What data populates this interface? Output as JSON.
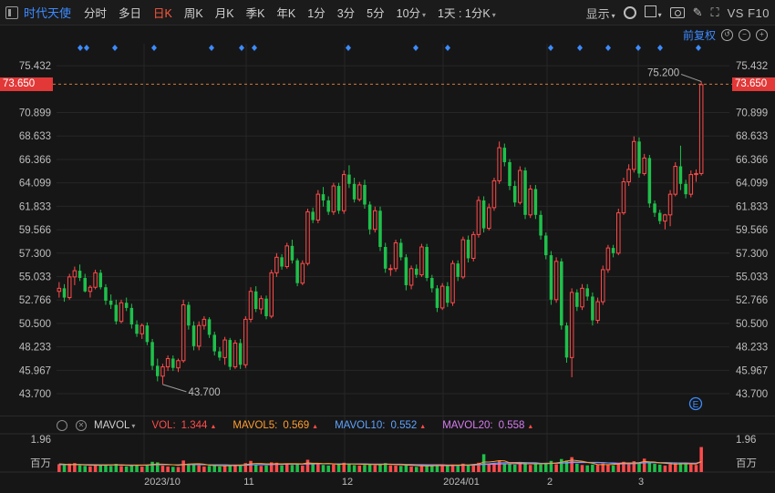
{
  "toolbar": {
    "app_title": "时代天使",
    "periods": [
      "分时",
      "多日",
      "日K",
      "周K",
      "月K",
      "季K",
      "年K",
      "1分",
      "3分",
      "5分",
      "10分",
      "1天 : 1分K"
    ],
    "active_period": "日K",
    "display_label": "显示",
    "f10_label": "VS F10"
  },
  "adjust": {
    "label": "前复权"
  },
  "price_axis": {
    "ticks": [
      "75.432",
      "73.650",
      "70.899",
      "68.633",
      "66.366",
      "64.099",
      "61.833",
      "59.566",
      "57.300",
      "55.033",
      "52.766",
      "50.500",
      "48.233",
      "45.967",
      "43.700"
    ],
    "current_price": "73.650"
  },
  "annotations": {
    "high": "75.200",
    "low": "43.700",
    "event_marker": "E"
  },
  "volume": {
    "indicator_name": "MAVOL",
    "vol_label": "VOL:",
    "vol_value": "1.344",
    "mavol5_label": "MAVOL5:",
    "mavol5_value": "0.569",
    "mavol10_label": "MAVOL10:",
    "mavol10_value": "0.552",
    "mavol20_label": "MAVOL20:",
    "mavol20_value": "0.558",
    "axis_top": "1.96",
    "axis_unit": "百万"
  },
  "date_axis": {
    "labels": [
      "2023/10",
      "11",
      "12",
      "2024/01",
      "2",
      "3"
    ]
  },
  "colors": {
    "up": "#ff4b4b",
    "down": "#1fc04b",
    "mavol5": "#ff9d2e",
    "mavol10": "#5fa3ff",
    "mavol20": "#d77cf0",
    "accent": "#3d8bff"
  },
  "chart_data": {
    "type": "candlestick",
    "y_range": [
      43.0,
      76.5
    ],
    "volume_range": [
      0,
      1.96
    ],
    "candles": [
      [
        53.6,
        54.5,
        53.0,
        53.9
      ],
      [
        53.9,
        54.3,
        52.6,
        53.0
      ],
      [
        53.0,
        55.3,
        52.8,
        55.0
      ],
      [
        55.0,
        56.0,
        54.2,
        55.6
      ],
      [
        55.6,
        56.2,
        54.6,
        54.9
      ],
      [
        54.9,
        55.3,
        53.5,
        53.6
      ],
      [
        53.6,
        54.2,
        53.0,
        54.0
      ],
      [
        54.0,
        55.7,
        53.8,
        55.4
      ],
      [
        55.4,
        55.7,
        53.8,
        54.0
      ],
      [
        54.0,
        54.3,
        52.3,
        52.7
      ],
      [
        52.7,
        53.3,
        51.9,
        52.3
      ],
      [
        52.3,
        52.8,
        50.4,
        50.7
      ],
      [
        50.7,
        52.8,
        50.5,
        52.5
      ],
      [
        52.5,
        53.0,
        51.7,
        52.0
      ],
      [
        52.0,
        52.4,
        50.0,
        50.4
      ],
      [
        50.4,
        50.8,
        49.2,
        49.5
      ],
      [
        49.5,
        50.5,
        49.0,
        50.3
      ],
      [
        50.3,
        50.6,
        48.4,
        48.7
      ],
      [
        48.7,
        49.0,
        46.0,
        46.4
      ],
      [
        46.4,
        47.1,
        44.9,
        45.4
      ],
      [
        45.4,
        46.6,
        44.6,
        46.3
      ],
      [
        46.3,
        47.4,
        45.9,
        47.1
      ],
      [
        47.1,
        47.4,
        45.9,
        46.2
      ],
      [
        46.2,
        47.1,
        45.8,
        46.9
      ],
      [
        46.9,
        52.8,
        46.7,
        52.3
      ],
      [
        52.3,
        52.6,
        49.9,
        50.3
      ],
      [
        50.3,
        50.7,
        47.9,
        48.3
      ],
      [
        48.3,
        50.7,
        47.9,
        50.3
      ],
      [
        50.3,
        51.2,
        49.9,
        50.9
      ],
      [
        50.9,
        51.1,
        49.1,
        49.4
      ],
      [
        49.4,
        49.7,
        47.4,
        47.8
      ],
      [
        47.8,
        48.2,
        46.9,
        47.2
      ],
      [
        47.2,
        49.2,
        46.5,
        48.9
      ],
      [
        48.9,
        49.1,
        46.0,
        46.3
      ],
      [
        46.3,
        48.9,
        46.1,
        48.6
      ],
      [
        48.6,
        49.0,
        46.1,
        46.5
      ],
      [
        46.5,
        51.2,
        46.2,
        50.9
      ],
      [
        50.9,
        54.0,
        50.6,
        53.6
      ],
      [
        53.6,
        54.1,
        51.6,
        51.9
      ],
      [
        51.9,
        53.2,
        51.4,
        52.9
      ],
      [
        52.9,
        53.2,
        50.9,
        51.2
      ],
      [
        51.2,
        55.7,
        51.0,
        55.4
      ],
      [
        55.4,
        57.3,
        55.0,
        56.9
      ],
      [
        56.9,
        57.2,
        55.7,
        56.0
      ],
      [
        56.0,
        58.3,
        55.8,
        58.0
      ],
      [
        58.0,
        58.6,
        56.3,
        56.6
      ],
      [
        56.6,
        56.8,
        54.1,
        54.4
      ],
      [
        54.4,
        56.6,
        54.2,
        56.3
      ],
      [
        56.3,
        61.6,
        56.1,
        61.3
      ],
      [
        61.3,
        61.7,
        60.2,
        60.5
      ],
      [
        60.5,
        63.4,
        60.2,
        63.0
      ],
      [
        63.0,
        63.7,
        61.8,
        62.4
      ],
      [
        62.4,
        62.8,
        61.0,
        61.3
      ],
      [
        61.3,
        64.1,
        61.0,
        63.8
      ],
      [
        63.8,
        64.1,
        61.1,
        61.4
      ],
      [
        61.4,
        65.3,
        61.1,
        64.9
      ],
      [
        64.9,
        65.8,
        63.6,
        64.0
      ],
      [
        64.0,
        64.6,
        62.2,
        62.5
      ],
      [
        62.5,
        64.2,
        62.3,
        63.9
      ],
      [
        63.9,
        64.4,
        61.6,
        62.0
      ],
      [
        62.0,
        62.3,
        59.1,
        59.6
      ],
      [
        59.6,
        61.8,
        59.3,
        61.4
      ],
      [
        61.4,
        61.8,
        57.5,
        57.9
      ],
      [
        57.9,
        58.3,
        55.4,
        55.8
      ],
      [
        55.8,
        56.2,
        55.1,
        55.8
      ],
      [
        55.8,
        58.6,
        55.5,
        58.3
      ],
      [
        58.3,
        58.7,
        56.6,
        56.9
      ],
      [
        56.9,
        57.2,
        53.7,
        54.2
      ],
      [
        54.2,
        56.1,
        53.8,
        55.8
      ],
      [
        55.8,
        56.2,
        54.9,
        55.2
      ],
      [
        55.2,
        58.2,
        55.0,
        57.9
      ],
      [
        57.9,
        58.2,
        54.6,
        54.9
      ],
      [
        54.9,
        55.2,
        53.5,
        53.9
      ],
      [
        53.9,
        54.2,
        51.6,
        52.0
      ],
      [
        52.0,
        54.4,
        51.8,
        54.1
      ],
      [
        54.1,
        54.5,
        52.1,
        52.5
      ],
      [
        52.5,
        56.6,
        52.2,
        56.3
      ],
      [
        56.3,
        56.6,
        54.6,
        55.0
      ],
      [
        55.0,
        58.9,
        54.8,
        58.6
      ],
      [
        58.6,
        59.0,
        56.4,
        56.8
      ],
      [
        56.8,
        59.4,
        56.5,
        59.1
      ],
      [
        59.1,
        62.8,
        58.8,
        62.4
      ],
      [
        62.4,
        62.8,
        59.3,
        59.7
      ],
      [
        59.7,
        62.1,
        59.5,
        61.7
      ],
      [
        61.7,
        64.6,
        61.4,
        64.3
      ],
      [
        64.3,
        68.1,
        64.0,
        67.5
      ],
      [
        67.5,
        67.9,
        65.7,
        66.1
      ],
      [
        66.1,
        66.4,
        63.4,
        63.8
      ],
      [
        63.8,
        64.3,
        61.8,
        62.2
      ],
      [
        62.2,
        65.7,
        62.0,
        65.3
      ],
      [
        65.3,
        65.6,
        60.6,
        61.0
      ],
      [
        61.0,
        63.9,
        60.7,
        63.5
      ],
      [
        63.5,
        63.9,
        60.6,
        61.0
      ],
      [
        61.0,
        61.4,
        58.6,
        59.0
      ],
      [
        59.0,
        59.3,
        56.7,
        57.1
      ],
      [
        57.1,
        57.5,
        52.3,
        52.8
      ],
      [
        52.8,
        56.9,
        52.5,
        56.5
      ],
      [
        56.5,
        56.8,
        49.9,
        50.3
      ],
      [
        50.3,
        50.6,
        46.7,
        47.2
      ],
      [
        47.2,
        53.9,
        45.3,
        53.5
      ],
      [
        53.5,
        53.8,
        51.7,
        52.1
      ],
      [
        52.1,
        54.3,
        51.8,
        53.9
      ],
      [
        53.9,
        54.3,
        52.7,
        53.1
      ],
      [
        53.1,
        53.5,
        50.3,
        50.8
      ],
      [
        50.8,
        53.0,
        50.5,
        52.6
      ],
      [
        52.6,
        56.1,
        52.3,
        55.7
      ],
      [
        55.7,
        58.1,
        55.4,
        57.8
      ],
      [
        57.8,
        58.1,
        56.9,
        57.3
      ],
      [
        57.3,
        61.6,
        57.1,
        61.2
      ],
      [
        61.2,
        64.6,
        61.0,
        64.2
      ],
      [
        64.2,
        65.9,
        63.8,
        65.4
      ],
      [
        65.4,
        68.6,
        65.1,
        68.1
      ],
      [
        68.1,
        68.5,
        64.6,
        65.0
      ],
      [
        65.0,
        66.9,
        64.8,
        66.5
      ],
      [
        66.5,
        66.8,
        61.7,
        62.1
      ],
      [
        62.1,
        62.4,
        60.8,
        61.2
      ],
      [
        61.2,
        61.5,
        60.1,
        60.4
      ],
      [
        60.4,
        61.1,
        59.6,
        61.0
      ],
      [
        61.0,
        63.4,
        59.9,
        63.0
      ],
      [
        63.0,
        66.1,
        62.8,
        65.7
      ],
      [
        65.7,
        67.7,
        63.4,
        64.0
      ],
      [
        64.0,
        64.4,
        62.6,
        63.0
      ],
      [
        63.0,
        65.3,
        62.7,
        64.9
      ],
      [
        64.9,
        65.4,
        64.2,
        65.0
      ],
      [
        65.0,
        73.9,
        64.8,
        73.6
      ]
    ],
    "volumes": [
      0.42,
      0.38,
      0.45,
      0.48,
      0.36,
      0.33,
      0.31,
      0.4,
      0.35,
      0.37,
      0.33,
      0.44,
      0.32,
      0.3,
      0.36,
      0.38,
      0.29,
      0.35,
      0.55,
      0.52,
      0.34,
      0.3,
      0.28,
      0.27,
      0.62,
      0.44,
      0.4,
      0.36,
      0.3,
      0.33,
      0.35,
      0.3,
      0.32,
      0.38,
      0.34,
      0.36,
      0.48,
      0.6,
      0.4,
      0.33,
      0.35,
      0.52,
      0.5,
      0.36,
      0.44,
      0.38,
      0.42,
      0.35,
      0.66,
      0.45,
      0.48,
      0.38,
      0.35,
      0.41,
      0.4,
      0.5,
      0.42,
      0.37,
      0.35,
      0.38,
      0.42,
      0.36,
      0.44,
      0.48,
      0.36,
      0.34,
      0.33,
      0.4,
      0.3,
      0.28,
      0.35,
      0.36,
      0.33,
      0.38,
      0.32,
      0.36,
      0.4,
      0.33,
      0.45,
      0.36,
      0.4,
      0.5,
      0.96,
      0.45,
      0.5,
      0.62,
      0.42,
      0.44,
      0.4,
      0.46,
      0.52,
      0.38,
      0.43,
      0.41,
      0.44,
      0.6,
      0.42,
      0.7,
      0.62,
      0.8,
      0.45,
      0.38,
      0.36,
      0.4,
      0.38,
      0.46,
      0.42,
      0.36,
      0.48,
      0.55,
      0.44,
      0.58,
      0.46,
      0.72,
      0.5,
      0.44,
      0.4,
      0.35,
      0.42,
      0.52,
      0.5,
      0.42,
      0.41,
      0.38,
      1.344
    ],
    "mavol5": [
      0.44,
      0.42,
      0.4,
      0.41,
      0.4,
      0.38,
      0.37,
      0.36,
      0.36,
      0.37,
      0.38,
      0.39,
      0.38,
      0.36,
      0.35,
      0.37,
      0.36,
      0.38,
      0.41,
      0.43,
      0.42,
      0.41,
      0.39,
      0.36,
      0.4,
      0.43,
      0.44,
      0.45,
      0.42,
      0.37,
      0.35,
      0.34,
      0.33,
      0.34,
      0.35,
      0.37,
      0.4,
      0.44,
      0.46,
      0.46,
      0.44,
      0.44,
      0.45,
      0.44,
      0.45,
      0.45,
      0.45,
      0.44,
      0.49,
      0.47,
      0.47,
      0.45,
      0.46,
      0.44,
      0.41,
      0.43,
      0.43,
      0.43,
      0.42,
      0.41,
      0.41,
      0.4,
      0.4,
      0.42,
      0.42,
      0.4,
      0.39,
      0.38,
      0.36,
      0.35,
      0.33,
      0.33,
      0.33,
      0.35,
      0.35,
      0.35,
      0.36,
      0.37,
      0.38,
      0.38,
      0.41,
      0.43,
      0.54,
      0.54,
      0.57,
      0.61,
      0.6,
      0.5,
      0.5,
      0.47,
      0.45,
      0.44,
      0.44,
      0.44,
      0.45,
      0.46,
      0.49,
      0.53,
      0.59,
      0.64,
      0.61,
      0.58,
      0.52,
      0.47,
      0.4,
      0.4,
      0.4,
      0.41,
      0.43,
      0.47,
      0.48,
      0.49,
      0.51,
      0.57,
      0.55,
      0.54,
      0.49,
      0.47,
      0.45,
      0.42,
      0.44,
      0.44,
      0.44,
      0.43,
      0.569
    ],
    "mavol10": [
      0.4,
      0.4,
      0.4,
      0.4,
      0.41,
      0.4,
      0.4,
      0.39,
      0.38,
      0.38,
      0.38,
      0.38,
      0.37,
      0.37,
      0.36,
      0.37,
      0.37,
      0.37,
      0.39,
      0.4,
      0.4,
      0.39,
      0.39,
      0.39,
      0.41,
      0.42,
      0.41,
      0.4,
      0.4,
      0.39,
      0.39,
      0.39,
      0.38,
      0.37,
      0.35,
      0.35,
      0.36,
      0.38,
      0.4,
      0.41,
      0.41,
      0.42,
      0.43,
      0.44,
      0.45,
      0.45,
      0.44,
      0.44,
      0.46,
      0.46,
      0.46,
      0.45,
      0.45,
      0.44,
      0.43,
      0.44,
      0.44,
      0.44,
      0.43,
      0.43,
      0.42,
      0.41,
      0.41,
      0.42,
      0.41,
      0.4,
      0.39,
      0.39,
      0.39,
      0.38,
      0.37,
      0.36,
      0.36,
      0.36,
      0.35,
      0.35,
      0.35,
      0.35,
      0.36,
      0.36,
      0.37,
      0.39,
      0.44,
      0.45,
      0.47,
      0.49,
      0.5,
      0.5,
      0.51,
      0.52,
      0.51,
      0.5,
      0.5,
      0.47,
      0.47,
      0.47,
      0.47,
      0.49,
      0.51,
      0.55,
      0.54,
      0.53,
      0.52,
      0.52,
      0.52,
      0.51,
      0.49,
      0.46,
      0.43,
      0.44,
      0.44,
      0.45,
      0.46,
      0.5,
      0.5,
      0.51,
      0.5,
      0.51,
      0.5,
      0.49,
      0.49,
      0.47,
      0.46,
      0.45,
      0.552
    ],
    "mavol20": [
      0.4,
      0.4,
      0.4,
      0.4,
      0.4,
      0.4,
      0.4,
      0.4,
      0.39,
      0.39,
      0.39,
      0.39,
      0.39,
      0.38,
      0.38,
      0.38,
      0.38,
      0.38,
      0.38,
      0.39,
      0.39,
      0.39,
      0.39,
      0.39,
      0.4,
      0.4,
      0.4,
      0.4,
      0.39,
      0.39,
      0.39,
      0.39,
      0.39,
      0.38,
      0.38,
      0.38,
      0.38,
      0.39,
      0.39,
      0.39,
      0.39,
      0.4,
      0.41,
      0.41,
      0.42,
      0.42,
      0.42,
      0.42,
      0.43,
      0.43,
      0.44,
      0.44,
      0.44,
      0.44,
      0.44,
      0.44,
      0.44,
      0.44,
      0.44,
      0.44,
      0.43,
      0.43,
      0.43,
      0.43,
      0.42,
      0.42,
      0.42,
      0.41,
      0.41,
      0.4,
      0.4,
      0.39,
      0.39,
      0.39,
      0.39,
      0.38,
      0.38,
      0.38,
      0.38,
      0.38,
      0.38,
      0.39,
      0.41,
      0.41,
      0.42,
      0.43,
      0.44,
      0.44,
      0.45,
      0.45,
      0.45,
      0.46,
      0.46,
      0.46,
      0.47,
      0.47,
      0.47,
      0.48,
      0.49,
      0.51,
      0.51,
      0.51,
      0.51,
      0.5,
      0.5,
      0.5,
      0.49,
      0.49,
      0.48,
      0.49,
      0.49,
      0.49,
      0.49,
      0.5,
      0.51,
      0.51,
      0.5,
      0.5,
      0.49,
      0.49,
      0.49,
      0.49,
      0.48,
      0.48,
      0.558
    ]
  }
}
